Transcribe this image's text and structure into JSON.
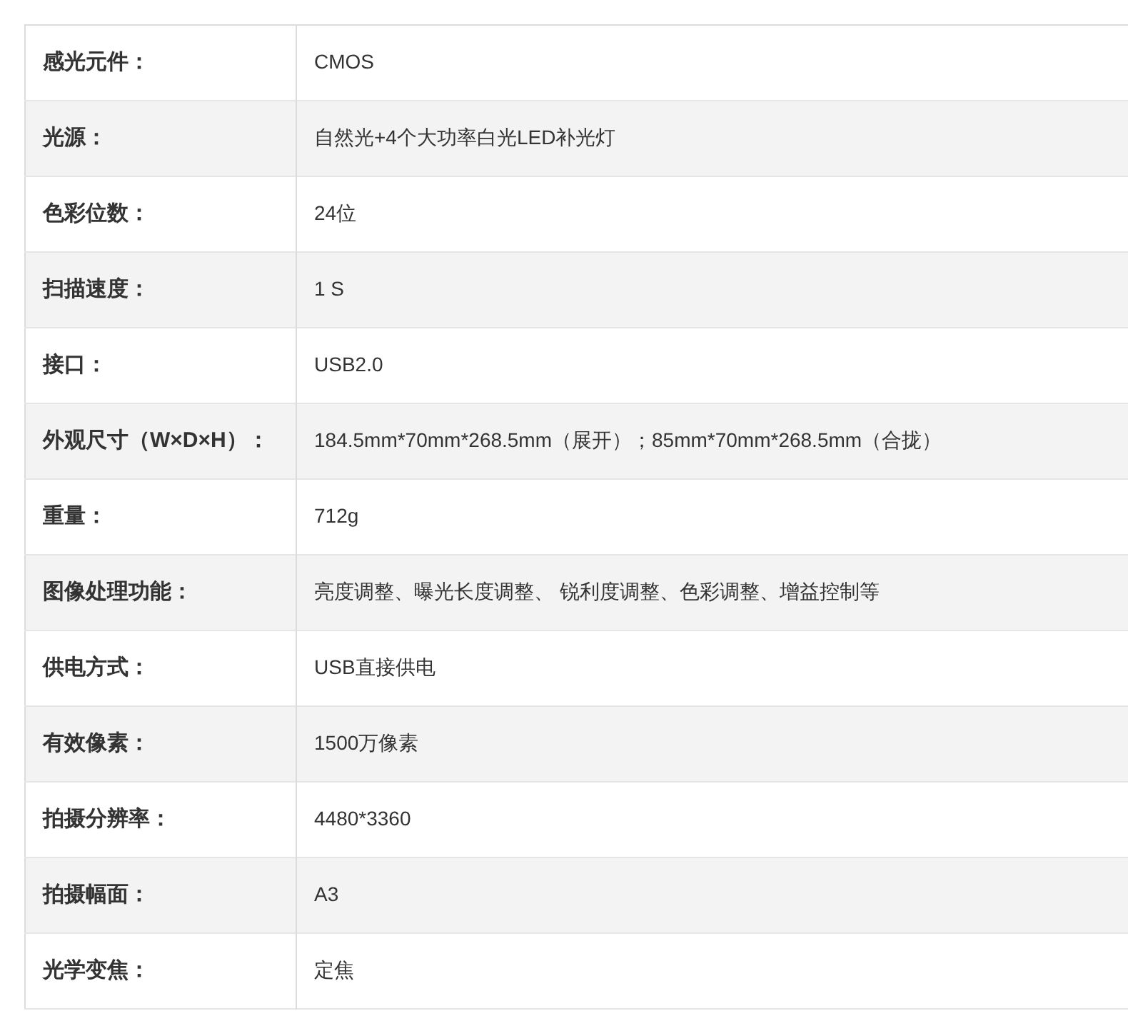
{
  "spec_rows": [
    {
      "label": "感光元件：",
      "value": "CMOS"
    },
    {
      "label": "光源：",
      "value": "自然光+4个大功率白光LED补光灯"
    },
    {
      "label": "色彩位数：",
      "value": "24位"
    },
    {
      "label": "扫描速度：",
      "value": "1 S"
    },
    {
      "label": "接口：",
      "value": "USB2.0"
    },
    {
      "label": "外观尺寸（W×D×H）：",
      "value": "184.5mm*70mm*268.5mm（展开）；85mm*70mm*268.5mm（合拢）"
    },
    {
      "label": "重量：",
      "value": "712g"
    },
    {
      "label": "图像处理功能：",
      "value": "亮度调整、曝光长度调整、 锐利度调整、色彩调整、增益控制等"
    },
    {
      "label": "供电方式：",
      "value": "USB直接供电"
    },
    {
      "label": "有效像素：",
      "value": "1500万像素"
    },
    {
      "label": "拍摄分辨率：",
      "value": "4480*3360"
    },
    {
      "label": "拍摄幅面：",
      "value": "A3"
    },
    {
      "label": "光学变焦：",
      "value": "定焦"
    }
  ]
}
